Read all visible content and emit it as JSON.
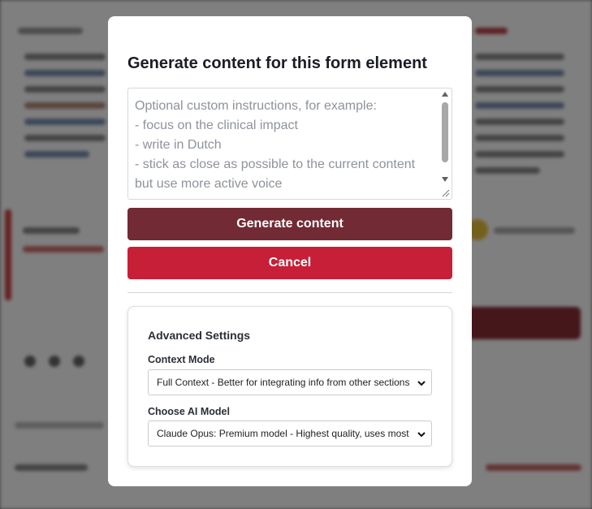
{
  "modal": {
    "title": "Generate content for this form element",
    "instructions_placeholder": "Optional custom instructions, for example:\n- focus on the clinical impact\n- write in Dutch\n- stick as close as possible to the current content but use more active voice",
    "generate_label": "Generate content",
    "cancel_label": "Cancel",
    "advanced": {
      "title": "Advanced Settings",
      "context_mode_label": "Context Mode",
      "context_mode_value": "Full Context - Better for integrating info from other sections",
      "model_label": "Choose AI Model",
      "model_value": "Claude Opus: Premium model - Highest quality, uses most credits"
    }
  },
  "colors": {
    "generate_button": "#722b34",
    "cancel_button": "#c71f37",
    "overlay": "rgba(0,0,0,0.5)"
  },
  "icons": [
    "scroll-up-arrow-icon",
    "scroll-down-arrow-icon",
    "resize-grip-icon",
    "chevron-down-icon"
  ]
}
